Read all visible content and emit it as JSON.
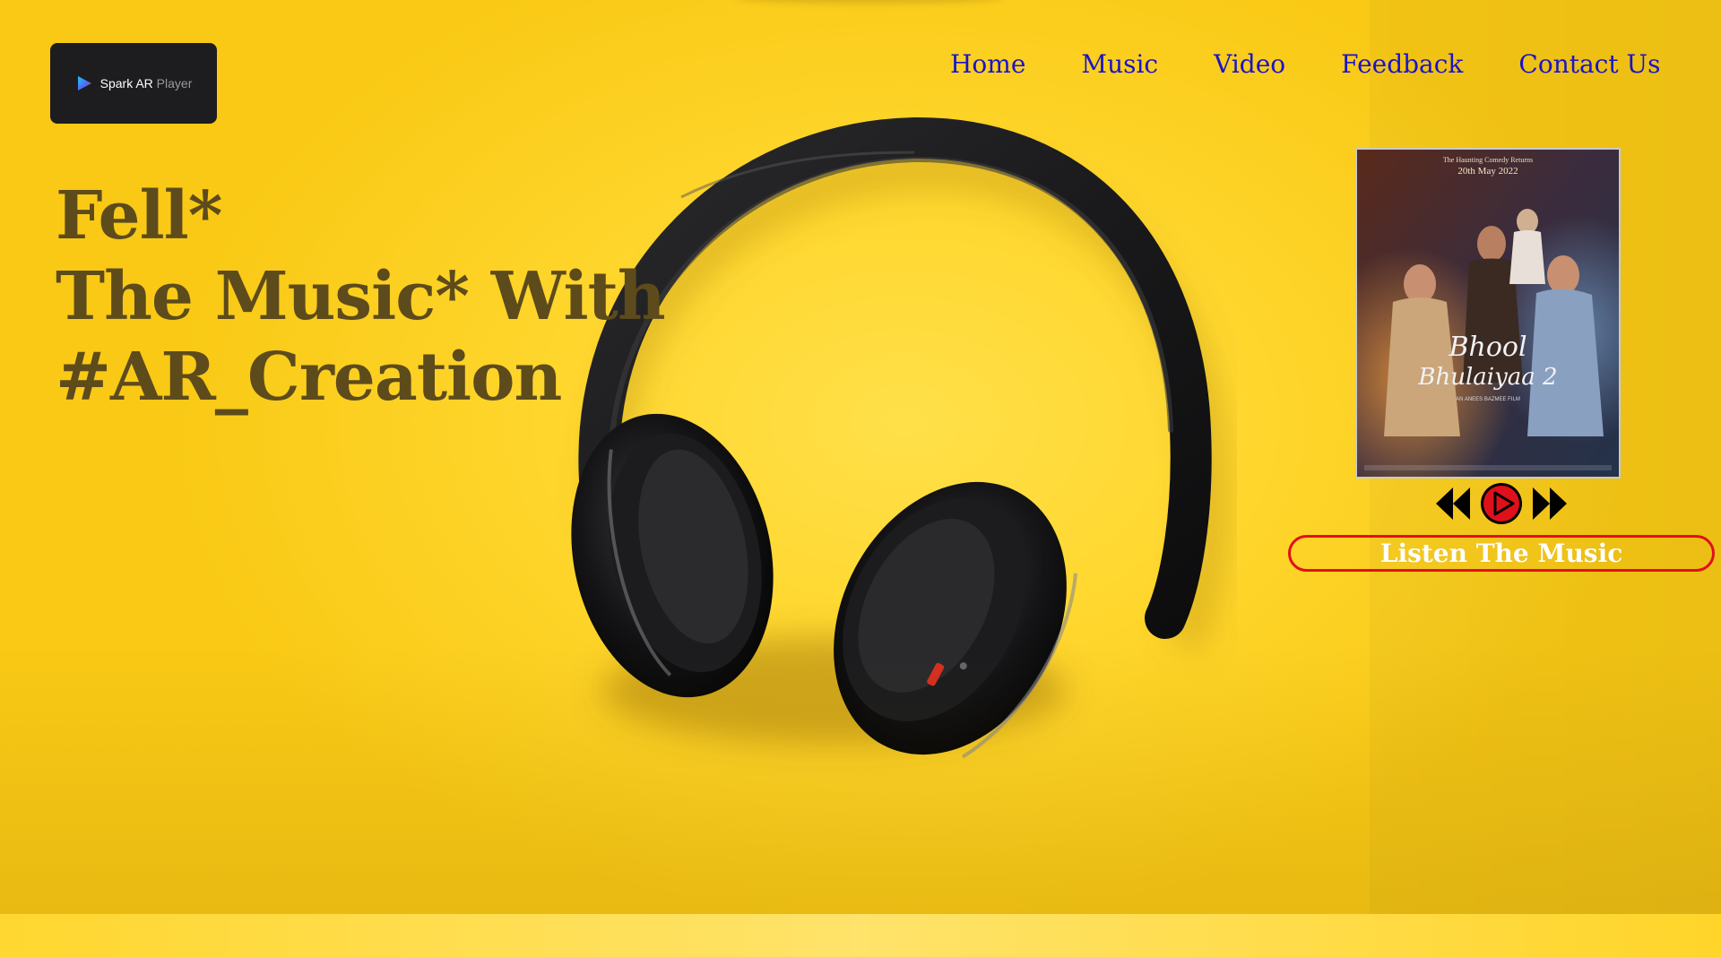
{
  "logo": {
    "name": "Spark AR",
    "suffix": "Player",
    "icon": "play-triangle-icon"
  },
  "nav": {
    "items": [
      {
        "label": "Home"
      },
      {
        "label": "Music"
      },
      {
        "label": "Video"
      },
      {
        "label": "Feedback"
      },
      {
        "label": "Contact Us"
      }
    ],
    "color": "#1a14c9"
  },
  "hero": {
    "lines": [
      "Fell*",
      "The Music* With",
      "#AR_Creation"
    ],
    "text_color": "#5d4b1c",
    "background_color": "#ffd72e",
    "image": "headphones-image"
  },
  "player": {
    "poster": {
      "tagline": "The Haunting Comedy Returns",
      "date": "20th May 2022",
      "title_line1": "Bhool",
      "title_line2": "Bhulaiyaa 2",
      "credit": "AN ANEES BAZMEE FILM"
    },
    "controls": [
      "rewind-icon",
      "play-icon",
      "fast-forward-icon"
    ],
    "accent_color": "#e0101a",
    "listen_label": "Listen The Music"
  }
}
